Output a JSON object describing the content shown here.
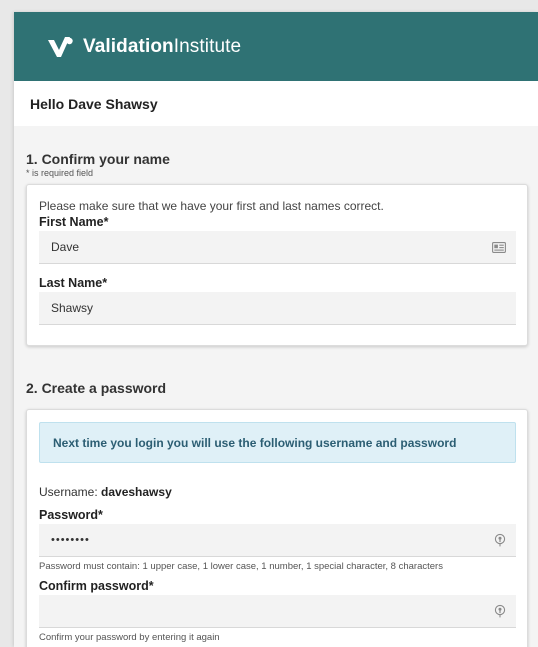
{
  "header": {
    "brand_bold": "Validation",
    "brand_light": "Institute",
    "logo_icon": "validation-check-logo-icon"
  },
  "greeting": "Hello Dave Shawsy",
  "section1": {
    "title": "1. Confirm your name",
    "required_note": "* is required field",
    "intro": "Please make sure that we have your first and last names correct.",
    "first_name_label": "First Name*",
    "first_name_value": "Dave",
    "first_name_icon": "contact-card-icon",
    "last_name_label": "Last Name*",
    "last_name_value": "Shawsy"
  },
  "section2": {
    "title": "2. Create a password",
    "info": "Next time you login you will use the following username and password",
    "username_label": "Username:",
    "username_value": "daveshawsy",
    "password_label": "Password*",
    "password_value": "••••••••",
    "password_icon": "password-key-icon",
    "password_hint": "Password must contain: 1 upper case, 1 lower case, 1 number, 1 special character, 8 characters",
    "confirm_label": "Confirm password*",
    "confirm_value": "",
    "confirm_icon": "password-key-icon",
    "confirm_hint": "Confirm your password by entering it again"
  },
  "colors": {
    "header_bg": "#2f7274",
    "info_bg": "#dff0f7",
    "info_text": "#2c5e73"
  }
}
